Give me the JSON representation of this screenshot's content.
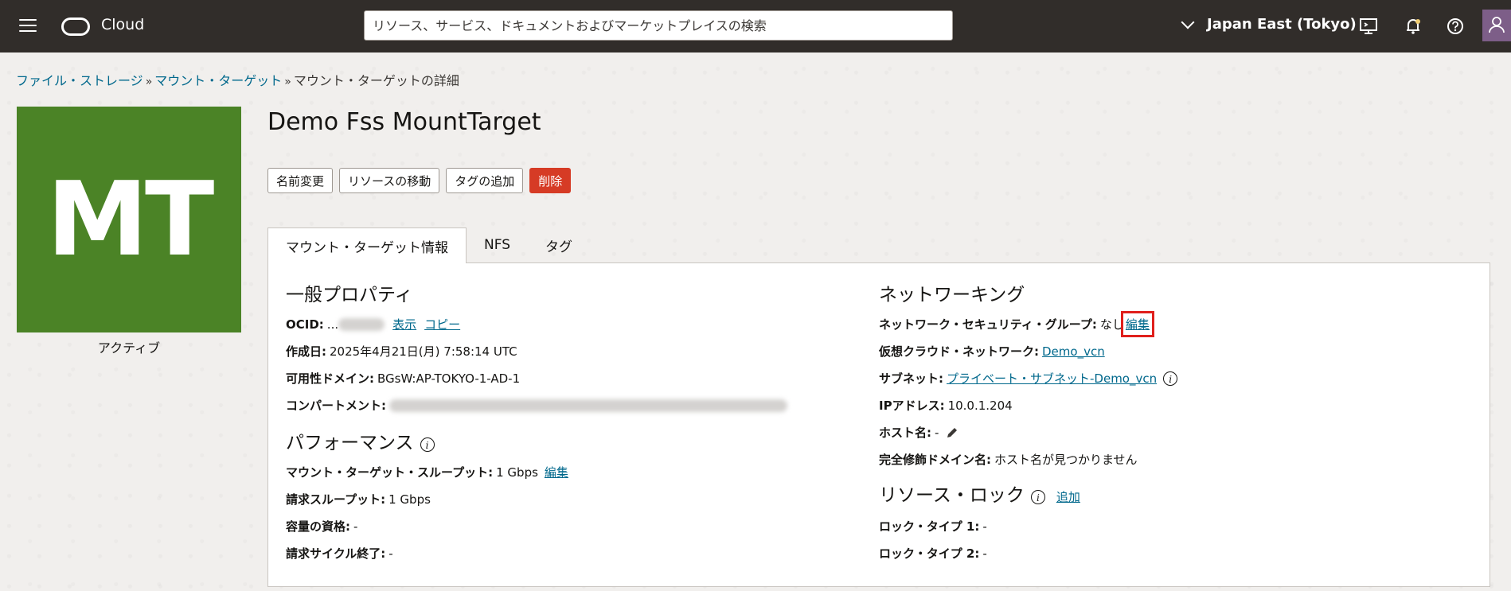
{
  "header": {
    "brand": "Cloud",
    "search_placeholder": "リソース、サービス、ドキュメントおよびマーケットプレイスの検索",
    "region": "Japan East (Tokyo)"
  },
  "breadcrumb": {
    "items": [
      "ファイル・ストレージ",
      "マウント・ターゲット"
    ],
    "separator": "»",
    "current": "マウント・ターゲットの詳細"
  },
  "resource": {
    "badge_text": "MT",
    "badge_color": "#4b8326",
    "state": "アクティブ",
    "title": "Demo Fss MountTarget"
  },
  "actions": {
    "rename": "名前変更",
    "move": "リソースの移動",
    "add_tags": "タグの追加",
    "delete": "削除"
  },
  "tabs": [
    "マウント・ターゲット情報",
    "NFS",
    "タグ"
  ],
  "general": {
    "title": "一般プロパティ",
    "ocid_label": "OCID:",
    "ocid_prefix": "...",
    "show": "表示",
    "copy": "コピー",
    "created_label": "作成日:",
    "created_value": "2025年4月21日(月) 7:58:14 UTC",
    "ad_label": "可用性ドメイン:",
    "ad_value": "BGsW:AP-TOKYO-1-AD-1",
    "compartment_label": "コンパートメント:"
  },
  "performance": {
    "title": "パフォーマンス",
    "throughput_label": "マウント・ターゲット・スループット:",
    "throughput_value": "1 Gbps",
    "edit": "編集",
    "billing_label": "請求スループット:",
    "billing_value": "1 Gbps",
    "capacity_label": "容量の資格:",
    "capacity_value": "-",
    "cycle_label": "請求サイクル終了:",
    "cycle_value": "-"
  },
  "networking": {
    "title": "ネットワーキング",
    "nsg_label": "ネットワーク・セキュリティ・グループ:",
    "nsg_value": "なし",
    "nsg_edit": "編集",
    "vcn_label": "仮想クラウド・ネットワーク:",
    "vcn_value": "Demo_vcn",
    "subnet_label": "サブネット:",
    "subnet_value": "プライベート・サブネット-Demo_vcn",
    "ip_label": "IPアドレス:",
    "ip_value": "10.0.1.204",
    "host_label": "ホスト名:",
    "host_value": "-",
    "fqdn_label": "完全修飾ドメイン名:",
    "fqdn_value": "ホスト名が見つかりません"
  },
  "locks": {
    "title": "リソース・ロック",
    "add": "追加",
    "lock1_label": "ロック・タイプ 1:",
    "lock1_value": "-",
    "lock2_label": "ロック・タイプ 2:",
    "lock2_value": "-"
  }
}
